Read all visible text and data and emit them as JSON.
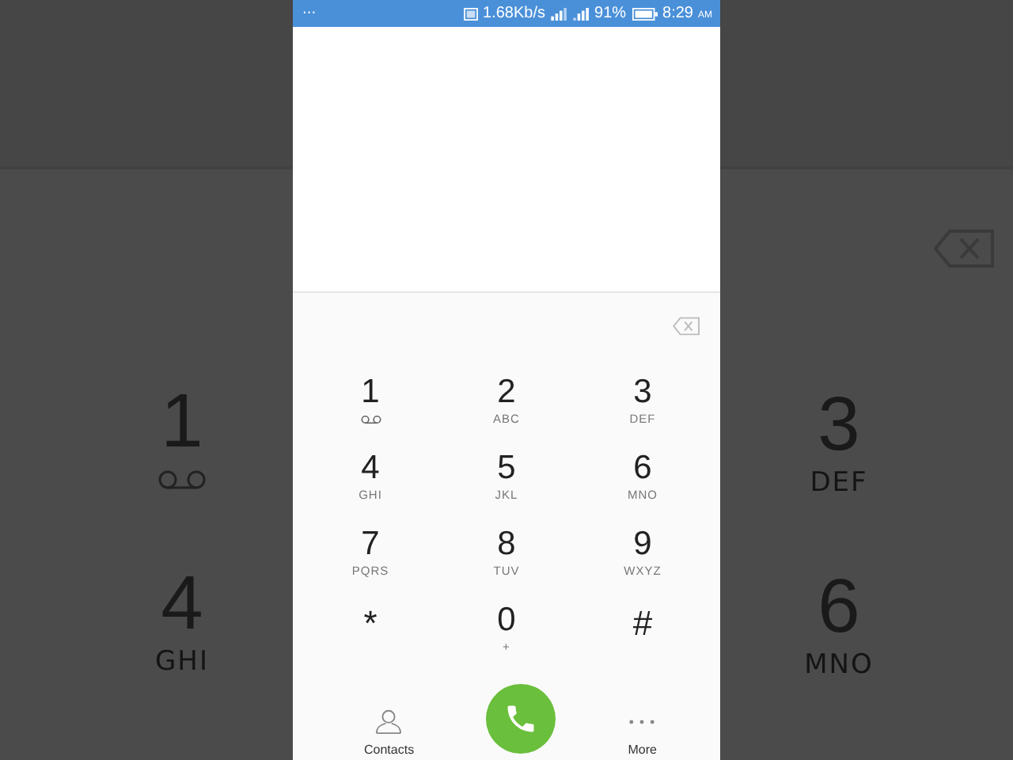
{
  "background_left": {
    "keys": [
      {
        "digit": "1",
        "kind": "voicemail"
      },
      {
        "digit": "4",
        "kind": "letters",
        "letters": "GHI"
      }
    ]
  },
  "background_right": {
    "keys": [
      {
        "digit": "3",
        "kind": "letters",
        "letters": "DEF"
      },
      {
        "digit": "6",
        "kind": "letters",
        "letters": "MNO"
      }
    ]
  },
  "status_bar": {
    "dots": "···",
    "speed": "1.68Kb/s",
    "battery": "91%",
    "time": "8:29",
    "meridiem": "AM"
  },
  "keypad": [
    {
      "digit": "1",
      "kind": "voicemail"
    },
    {
      "digit": "2",
      "kind": "letters",
      "letters": "ABC"
    },
    {
      "digit": "3",
      "kind": "letters",
      "letters": "DEF"
    },
    {
      "digit": "4",
      "kind": "letters",
      "letters": "GHI"
    },
    {
      "digit": "5",
      "kind": "letters",
      "letters": "JKL"
    },
    {
      "digit": "6",
      "kind": "letters",
      "letters": "MNO"
    },
    {
      "digit": "7",
      "kind": "letters",
      "letters": "PQRS"
    },
    {
      "digit": "8",
      "kind": "letters",
      "letters": "TUV"
    },
    {
      "digit": "9",
      "kind": "letters",
      "letters": "WXYZ"
    },
    {
      "digit": "*",
      "kind": "symbol"
    },
    {
      "digit": "0",
      "kind": "letters",
      "letters": "+"
    },
    {
      "digit": "#",
      "kind": "symbol"
    }
  ],
  "bottom_bar": {
    "contacts": "Contacts",
    "more": "More"
  }
}
